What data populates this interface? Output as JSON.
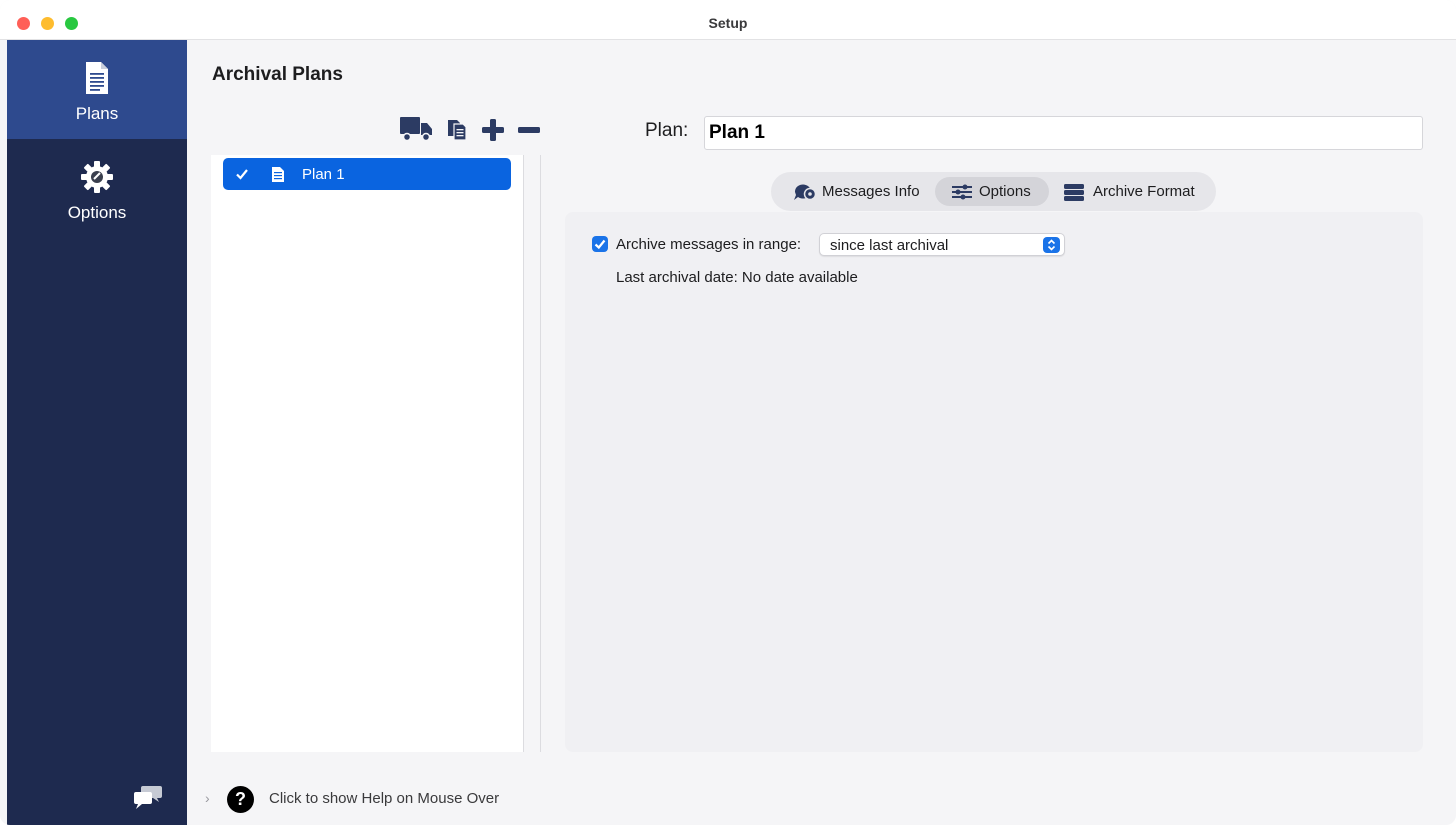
{
  "window": {
    "title": "Setup"
  },
  "sidebar": {
    "items": [
      {
        "label": "Plans",
        "icon": "document-icon",
        "active": true
      },
      {
        "label": "Options",
        "icon": "gear-icon",
        "active": false
      }
    ],
    "footer_icon": "chat-bubbles-icon"
  },
  "main": {
    "title": "Archival Plans",
    "toolbar": [
      "truck-icon",
      "copy-icon",
      "add-icon",
      "remove-icon"
    ],
    "plans": [
      {
        "label": "Plan 1",
        "checked": true,
        "selected": true
      }
    ],
    "plan_field": {
      "label": "Plan:",
      "value": "Plan 1"
    },
    "tabs": [
      {
        "label": "Messages Info",
        "icon": "messages-icon",
        "active": false
      },
      {
        "label": "Options",
        "icon": "sliders-icon",
        "active": true
      },
      {
        "label": "Archive Format",
        "icon": "database-icon",
        "active": false
      }
    ],
    "options": {
      "archive_range_label": "Archive messages in range:",
      "archive_range_checked": true,
      "range_value": "since last archival",
      "last_archival": "Last archival date: No date available"
    }
  },
  "footer": {
    "help_text": "Click to show Help on Mouse Over"
  },
  "colors": {
    "sidebar_bg": "#1e2a4f",
    "sidebar_active": "#2e4a8e",
    "selection_blue": "#0a64e0",
    "checkbox_blue": "#1a73e8"
  }
}
